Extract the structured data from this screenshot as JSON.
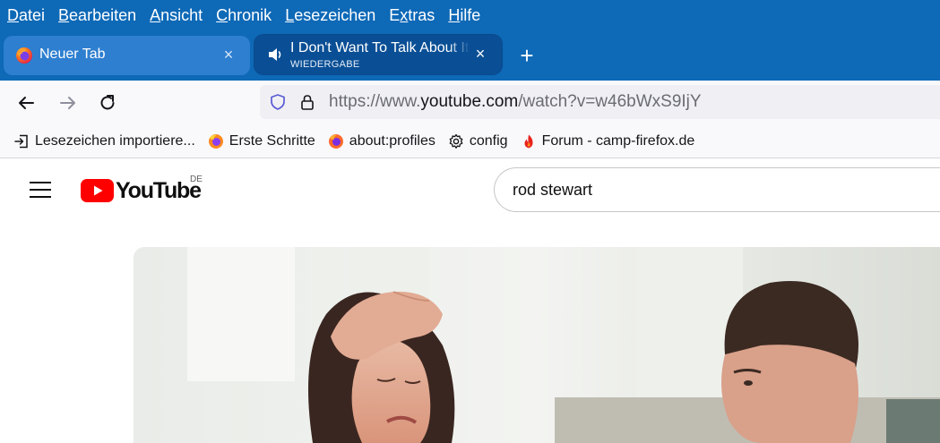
{
  "menubar": {
    "items": [
      {
        "label": "Datei",
        "u": "D",
        "rest": "atei"
      },
      {
        "label": "Bearbeiten",
        "u": "B",
        "rest": "earbeiten"
      },
      {
        "label": "Ansicht",
        "u": "A",
        "rest": "nsicht"
      },
      {
        "label": "Chronik",
        "u": "C",
        "rest": "hronik"
      },
      {
        "label": "Lesezeichen",
        "u": "L",
        "rest": "esezeichen"
      },
      {
        "label": "Extras",
        "pre": "E",
        "u": "x",
        "rest": "tras"
      },
      {
        "label": "Hilfe",
        "u": "H",
        "rest": "ilfe"
      }
    ]
  },
  "tabs": [
    {
      "title": "Neuer Tab",
      "icon": "firefox-icon",
      "close": "×"
    },
    {
      "title": "I Don't Want To Talk About It",
      "subtitle": "WIEDERGABE",
      "icon": "speaker-icon",
      "close": "×"
    }
  ],
  "newtab": {
    "label": "+"
  },
  "url": {
    "prefix": "https://www.",
    "host": "youtube.com",
    "path": "/watch?v=w46bWxS9IjY"
  },
  "bookmarks": [
    {
      "label": "Lesezeichen importiere...",
      "icon": "import-icon"
    },
    {
      "label": "Erste Schritte",
      "icon": "firefox-browser-icon"
    },
    {
      "label": "about:profiles",
      "icon": "firefox-icon"
    },
    {
      "label": "config",
      "icon": "gear-icon"
    },
    {
      "label": "Forum - camp-firefox.de",
      "icon": "flame-icon"
    }
  ],
  "youtube": {
    "wordmark": "YouTube",
    "country": "DE",
    "search_value": "rod stewart"
  },
  "colors": {
    "menubar": "#0e69b7",
    "active_tab": "#0a4f95",
    "youtube_red": "#ff0000"
  }
}
